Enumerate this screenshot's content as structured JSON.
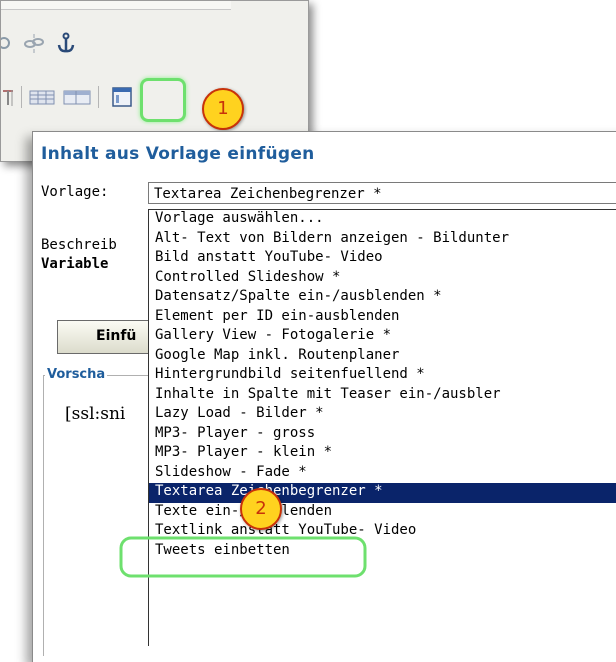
{
  "toolbar": {
    "icons_row1": [
      "unlink-icon",
      "link-broken-icon",
      "anchor-icon"
    ],
    "icons_row2": [
      "table-split-icon",
      "table-icon",
      "table-row-icon",
      "template-icon"
    ]
  },
  "markers": {
    "one": "1",
    "two": "2"
  },
  "dialog": {
    "title": "Inhalt aus Vorlage einfügen",
    "template_label": "Vorlage:",
    "selected_template": "Textarea Zeichenbegrenzer *",
    "description_label": "Beschreib",
    "variables_label": "Variable",
    "insert_button": "Einfü",
    "preview_legend": "Vorscha",
    "preview_content": "[ssl:sni"
  },
  "dropdown": {
    "options": [
      "Vorlage auswählen...",
      "Alt- Text von Bildern anzeigen - Bildunter",
      "Bild anstatt YouTube- Video",
      "Controlled Slideshow *",
      "Datensatz/Spalte ein-/ausblenden *",
      "Element per ID ein-ausblenden",
      "Gallery View - Fotogalerie *",
      "Google Map inkl. Routenplaner",
      "Hintergrundbild seitenfuellend *",
      "Inhalte in Spalte mit Teaser ein-/ausbler",
      "Lazy Load - Bilder *",
      "MP3- Player - gross",
      "MP3- Player - klein *",
      "Slideshow - Fade *",
      "Textarea Zeichenbegrenzer *",
      "Texte ein-/ausblenden",
      "Textlink anstatt YouTube- Video",
      "Tweets einbetten"
    ],
    "selected_index": 14
  },
  "colors": {
    "highlight": "#6ee06e",
    "marker_fill": "#ffd21f",
    "marker_border": "#c8320a",
    "selection": "#0a246a",
    "title": "#1f5d9c"
  }
}
